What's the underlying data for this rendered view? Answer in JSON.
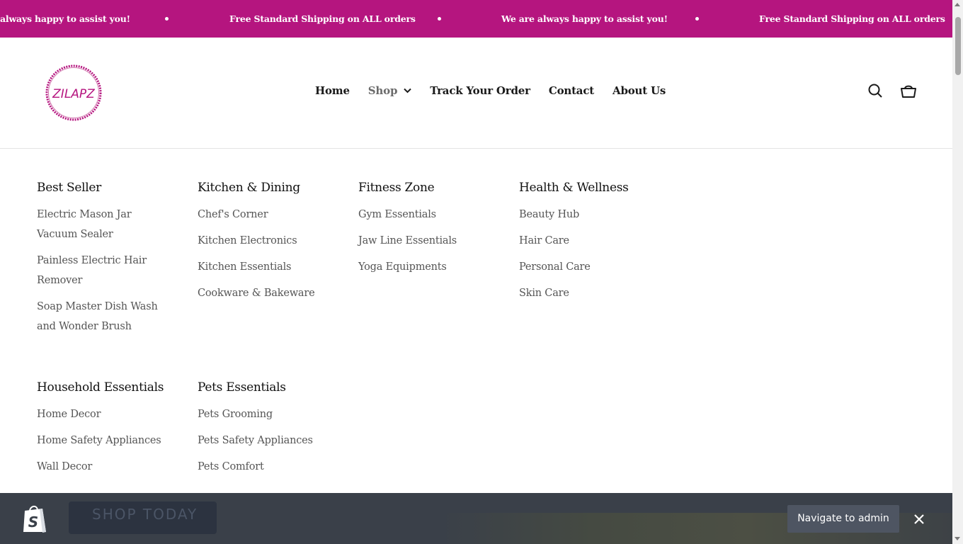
{
  "announcement": {
    "messages": [
      "always happy to assist you!",
      "Free Standard Shipping on ALL orders",
      "We are always happy to assist you!",
      "Free Standard Shipping on ALL orders"
    ]
  },
  "header": {
    "logo_text": "ZILAPZ",
    "nav": {
      "home": "Home",
      "shop": "Shop",
      "track": "Track Your Order",
      "contact": "Contact",
      "about": "About Us"
    },
    "icons": [
      "search-icon",
      "cart-icon"
    ]
  },
  "mega_menu": {
    "columns": [
      {
        "title": "Best Seller",
        "items": [
          "Electric Mason Jar Vacuum Sealer",
          "Painless Electric Hair Remover",
          "Soap Master Dish Wash and Wonder Brush"
        ]
      },
      {
        "title": "Kitchen & Dining",
        "items": [
          "Chef's Corner",
          "Kitchen Electronics",
          "Kitchen Essentials",
          "Cookware & Bakeware"
        ]
      },
      {
        "title": "Fitness Zone",
        "items": [
          "Gym Essentials",
          "Jaw Line Essentials",
          "Yoga Equipments"
        ]
      },
      {
        "title": "Health & Wellness",
        "items": [
          "Beauty Hub",
          "Hair Care",
          "Personal Care",
          "Skin Care"
        ]
      },
      {
        "title": "Household Essentials",
        "items": [
          "Home Decor",
          "Home Safety Appliances",
          "Wall Decor"
        ]
      },
      {
        "title": "Pets Essentials",
        "items": [
          "Pets Grooming",
          "Pets Safety Appliances",
          "Pets Comfort"
        ]
      }
    ]
  },
  "admin_bar": {
    "behind_button_text": "SHOP TODAY",
    "navigate_label": "Navigate to admin",
    "icons": [
      "shopify-bag-icon",
      "close-icon"
    ]
  },
  "colors": {
    "brand": "#b5157f",
    "admin_bar": "#3a4049",
    "text": "#1a1a1a",
    "muted": "#555555"
  }
}
